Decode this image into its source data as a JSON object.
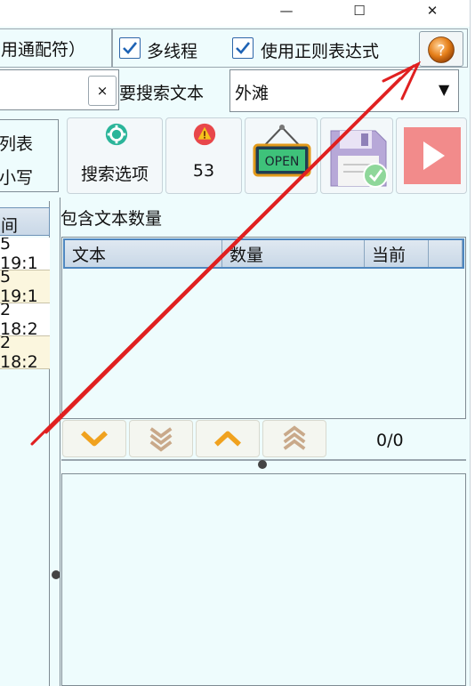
{
  "window": {
    "minimize_glyph": "—",
    "maximize_glyph": "☐",
    "close_glyph": "✕"
  },
  "options": {
    "wildcard_label": "用通配符）",
    "multithread_label": "多线程",
    "multithread_checked": true,
    "regex_label": "使用正则表达式",
    "regex_checked": true,
    "help_icon": "question-circle"
  },
  "search": {
    "clear_label": "×",
    "search_text_label": "搜索文本",
    "search_text_label_prefix": "要",
    "search_value": "外滩",
    "dropdown_arrow": "▼"
  },
  "left_panel": {
    "list_label": "列表",
    "case_label": "小写",
    "column_header": "间",
    "rows": [
      "5 19:1",
      "5 19:1",
      "2 18:2",
      "2 18:2"
    ]
  },
  "toolbar": {
    "search_options_label": "搜索选项",
    "count_label": "53",
    "open_sign_text": "OPEN",
    "icons": [
      "gear-icon",
      "alert-icon",
      "open-sign-icon",
      "save-icon",
      "play-icon"
    ]
  },
  "results": {
    "section_title": "包含文本数量",
    "columns": [
      "文本",
      "数量",
      "当前"
    ],
    "counter": "0/0"
  },
  "colors": {
    "client_bg": "#eefcfd",
    "accent_orange": "#f0a21f",
    "arrow_red": "#e02020",
    "play_red": "#f28b8b"
  }
}
